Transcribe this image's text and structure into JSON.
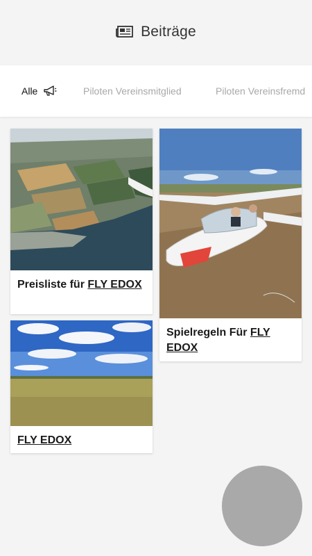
{
  "header": {
    "title": "Beiträge",
    "icon": "newspaper-icon"
  },
  "tabs": [
    {
      "label": "Alle",
      "icon": "megaphone-icon",
      "active": true
    },
    {
      "label": "Piloten Vereinsmitglied",
      "active": false
    },
    {
      "label": "Piloten Vereinsfremd",
      "active": false
    }
  ],
  "cards": [
    {
      "title_prefix": "Preisliste für ",
      "title_link": "FLY EDOX"
    },
    {
      "title_prefix": "Spielregeln Für ",
      "title_link": "FLY EDOX"
    },
    {
      "title_prefix": "",
      "title_link": "FLY EDOX"
    }
  ],
  "colors": {
    "background": "#f4f4f4",
    "fab": "#a9a9a9",
    "inactive_tab": "#a8a8a8"
  }
}
